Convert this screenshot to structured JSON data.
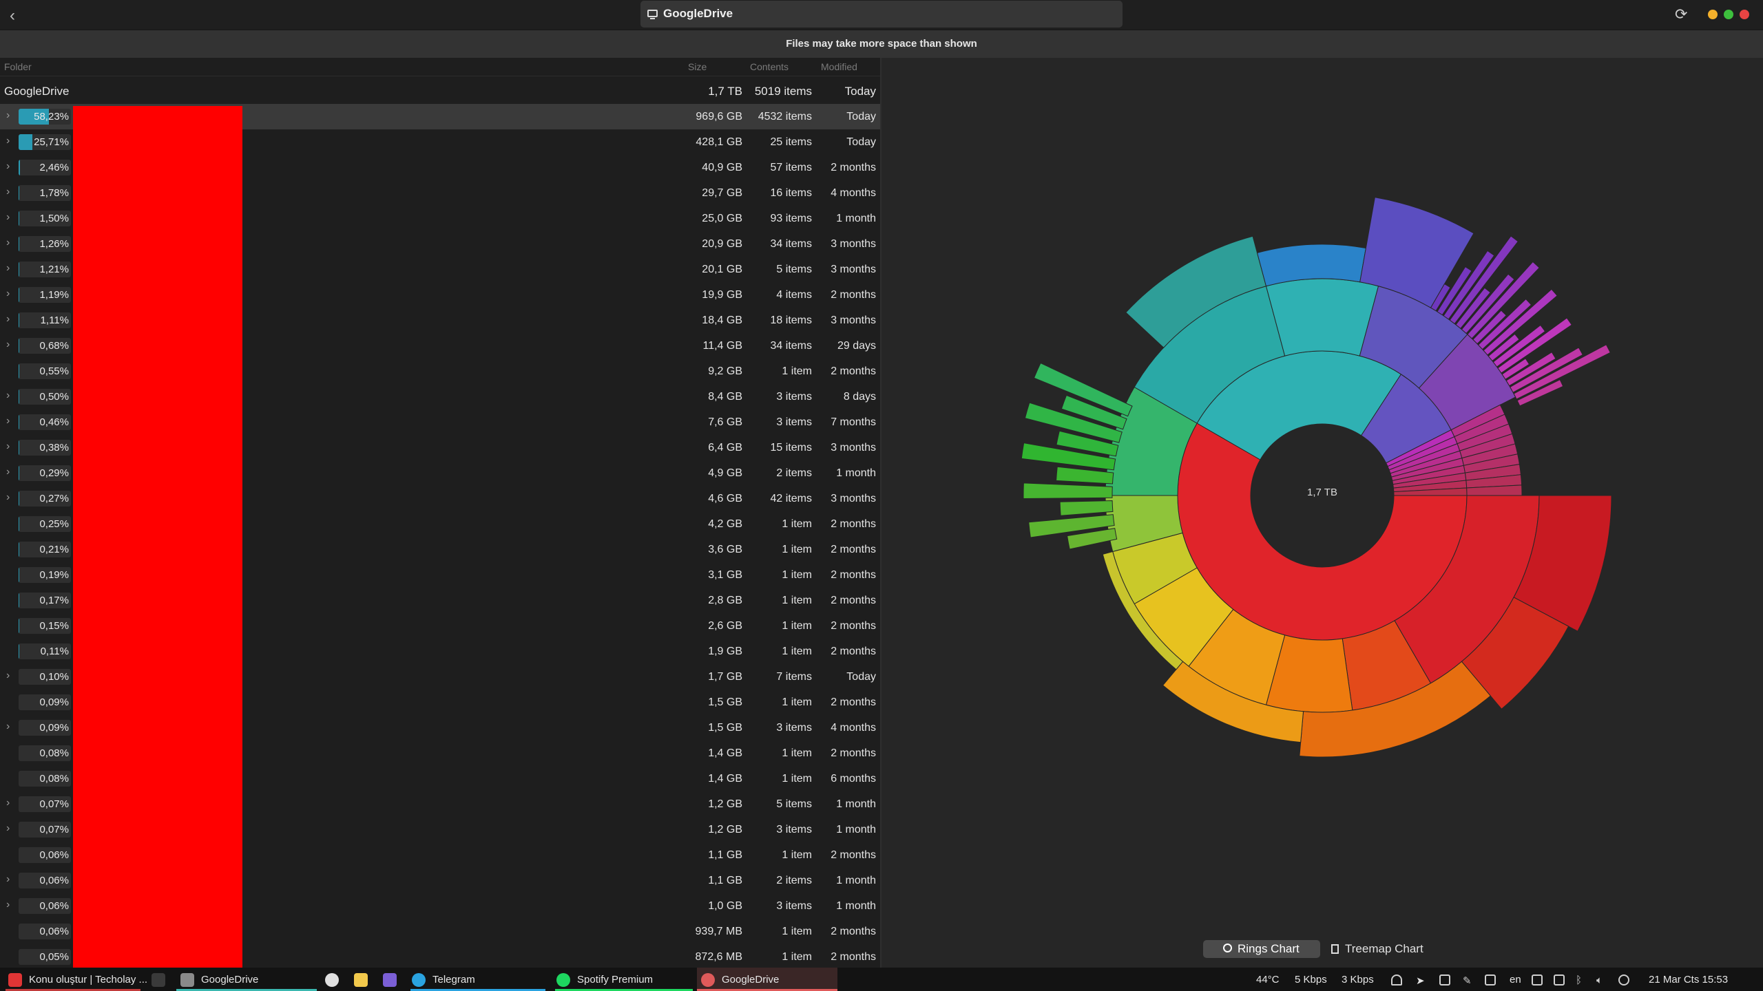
{
  "window": {
    "title": "GoogleDrive",
    "back_icon": "chevron-left-icon",
    "refresh_icon": "refresh-icon",
    "traffic_colors": [
      "#f3b02b",
      "#3dbf3d",
      "#e94443"
    ]
  },
  "notice": "Files may take more space than shown",
  "columns": {
    "folder": "Folder",
    "size": "Size",
    "contents": "Contents",
    "modified": "Modified"
  },
  "root": {
    "name": "GoogleDrive",
    "size": "1,7 TB",
    "contents": "5019 items",
    "modified": "Today"
  },
  "rows": [
    {
      "pct": "58,23%",
      "fill": 58.23,
      "size": "969,6 GB",
      "contents": "4532 items",
      "modified": "Today",
      "expand": true,
      "selected": true
    },
    {
      "pct": "25,71%",
      "fill": 25.71,
      "size": "428,1 GB",
      "contents": "25 items",
      "modified": "Today",
      "expand": true
    },
    {
      "pct": "2,46%",
      "fill": 2.46,
      "size": "40,9 GB",
      "contents": "57 items",
      "modified": "2 months",
      "expand": true
    },
    {
      "pct": "1,78%",
      "fill": 1.78,
      "size": "29,7 GB",
      "contents": "16 items",
      "modified": "4 months",
      "expand": true
    },
    {
      "pct": "1,50%",
      "fill": 1.5,
      "size": "25,0 GB",
      "contents": "93 items",
      "modified": "1 month",
      "expand": true
    },
    {
      "pct": "1,26%",
      "fill": 1.26,
      "size": "20,9 GB",
      "contents": "34 items",
      "modified": "3 months",
      "expand": true
    },
    {
      "pct": "1,21%",
      "fill": 1.21,
      "size": "20,1 GB",
      "contents": "5 items",
      "modified": "3 months",
      "expand": true
    },
    {
      "pct": "1,19%",
      "fill": 1.19,
      "size": "19,9 GB",
      "contents": "4 items",
      "modified": "2 months",
      "expand": true
    },
    {
      "pct": "1,11%",
      "fill": 1.11,
      "size": "18,4 GB",
      "contents": "18 items",
      "modified": "3 months",
      "expand": true
    },
    {
      "pct": "0,68%",
      "fill": 0.68,
      "size": "11,4 GB",
      "contents": "34 items",
      "modified": "29 days",
      "expand": true
    },
    {
      "pct": "0,55%",
      "fill": 0.55,
      "size": "9,2 GB",
      "contents": "1 item",
      "modified": "2 months",
      "expand": false
    },
    {
      "pct": "0,50%",
      "fill": 0.5,
      "size": "8,4 GB",
      "contents": "3 items",
      "modified": "8 days",
      "expand": true
    },
    {
      "pct": "0,46%",
      "fill": 0.46,
      "size": "7,6 GB",
      "contents": "3 items",
      "modified": "7 months",
      "expand": true
    },
    {
      "pct": "0,38%",
      "fill": 0.38,
      "size": "6,4 GB",
      "contents": "15 items",
      "modified": "3 months",
      "expand": true
    },
    {
      "pct": "0,29%",
      "fill": 0.29,
      "size": "4,9 GB",
      "contents": "2 items",
      "modified": "1 month",
      "expand": true
    },
    {
      "pct": "0,27%",
      "fill": 0.27,
      "size": "4,6 GB",
      "contents": "42 items",
      "modified": "3 months",
      "expand": true
    },
    {
      "pct": "0,25%",
      "fill": 0.25,
      "size": "4,2 GB",
      "contents": "1 item",
      "modified": "2 months",
      "expand": false
    },
    {
      "pct": "0,21%",
      "fill": 0.21,
      "size": "3,6 GB",
      "contents": "1 item",
      "modified": "2 months",
      "expand": false
    },
    {
      "pct": "0,19%",
      "fill": 0.19,
      "size": "3,1 GB",
      "contents": "1 item",
      "modified": "2 months",
      "expand": false
    },
    {
      "pct": "0,17%",
      "fill": 0.17,
      "size": "2,8 GB",
      "contents": "1 item",
      "modified": "2 months",
      "expand": false
    },
    {
      "pct": "0,15%",
      "fill": 0.15,
      "size": "2,6 GB",
      "contents": "1 item",
      "modified": "2 months",
      "expand": false
    },
    {
      "pct": "0,11%",
      "fill": 0.11,
      "size": "1,9 GB",
      "contents": "1 item",
      "modified": "2 months",
      "expand": false
    },
    {
      "pct": "0,10%",
      "fill": 0.1,
      "size": "1,7 GB",
      "contents": "7 items",
      "modified": "Today",
      "expand": true
    },
    {
      "pct": "0,09%",
      "fill": 0.09,
      "size": "1,5 GB",
      "contents": "1 item",
      "modified": "2 months",
      "expand": false
    },
    {
      "pct": "0,09%",
      "fill": 0.09,
      "size": "1,5 GB",
      "contents": "3 items",
      "modified": "4 months",
      "expand": true
    },
    {
      "pct": "0,08%",
      "fill": 0.08,
      "size": "1,4 GB",
      "contents": "1 item",
      "modified": "2 months",
      "expand": false
    },
    {
      "pct": "0,08%",
      "fill": 0.08,
      "size": "1,4 GB",
      "contents": "1 item",
      "modified": "6 months",
      "expand": false
    },
    {
      "pct": "0,07%",
      "fill": 0.07,
      "size": "1,2 GB",
      "contents": "5 items",
      "modified": "1 month",
      "expand": true
    },
    {
      "pct": "0,07%",
      "fill": 0.07,
      "size": "1,2 GB",
      "contents": "3 items",
      "modified": "1 month",
      "expand": true
    },
    {
      "pct": "0,06%",
      "fill": 0.06,
      "size": "1,1 GB",
      "contents": "1 item",
      "modified": "2 months",
      "expand": false
    },
    {
      "pct": "0,06%",
      "fill": 0.06,
      "size": "1,1 GB",
      "contents": "2 items",
      "modified": "1 month",
      "expand": true
    },
    {
      "pct": "0,06%",
      "fill": 0.06,
      "size": "1,0 GB",
      "contents": "3 items",
      "modified": "1 month",
      "expand": true
    },
    {
      "pct": "0,06%",
      "fill": 0.06,
      "size": "939,7 MB",
      "contents": "1 item",
      "modified": "2 months",
      "expand": false
    },
    {
      "pct": "0,05%",
      "fill": 0.05,
      "size": "872,6 MB",
      "contents": "1 item",
      "modified": "2 months",
      "expand": false
    }
  ],
  "chart": {
    "center_label": "1,7 TB",
    "rings_label": "Rings Chart",
    "treemap_label": "Treemap Chart",
    "selected_view": "rings"
  },
  "taskbar": {
    "apps": [
      {
        "label": "Konu oluştur | Techolay ...",
        "color": "#e03535"
      },
      {
        "label": "",
        "color": "#3a3a3a"
      },
      {
        "label": "GoogleDrive",
        "color": "#8a8a8a"
      },
      {
        "label": "",
        "color": "#e0e0e0"
      },
      {
        "label": "",
        "color": "#f2c94c"
      },
      {
        "label": "",
        "color": "#7b5fd6"
      },
      {
        "label": "Telegram",
        "color": "#2aa3e0"
      },
      {
        "label": "Spotify Premium",
        "color": "#1ed760"
      },
      {
        "label": "GoogleDrive",
        "color": "#e05a5a"
      }
    ],
    "temp": "44°C",
    "net_down": "5 Kbps",
    "net_up": "3 Kbps",
    "lang": "en",
    "datetime": "21 Mar Cts 15:53"
  }
}
